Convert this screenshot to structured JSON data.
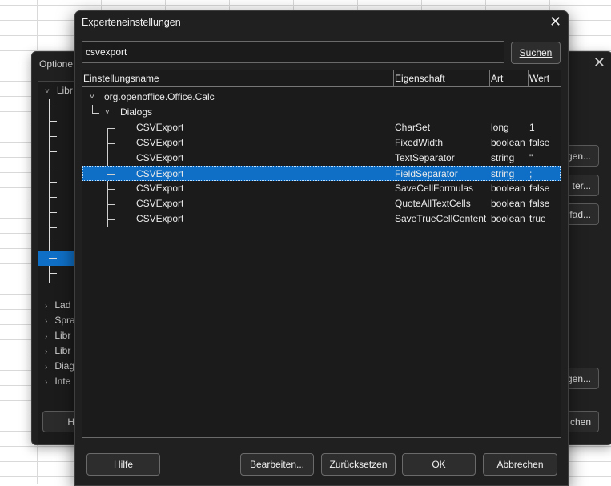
{
  "optionen": {
    "title": "Optione",
    "tree_items": [
      {
        "label": "Libr",
        "expanded": true
      },
      {
        "label": "Lad"
      },
      {
        "label": "Spra"
      },
      {
        "label": "Libr"
      },
      {
        "label": "Libr"
      },
      {
        "label": "Diag"
      },
      {
        "label": "Inte"
      }
    ],
    "right_buttons": [
      "gen...",
      "ter...",
      "fad...",
      "gen..."
    ],
    "bottom_left_button": "H",
    "bottom_right_button": "chen"
  },
  "expert": {
    "title": "Experteneinstellungen",
    "search_value": "csvexport",
    "search_button": "Suchen",
    "columns": [
      "Einstellungsname",
      "Eigenschaft",
      "Art",
      "Wert"
    ],
    "root": "org.openoffice.Office.Calc",
    "group": "Dialogs",
    "rows": [
      {
        "name": "CSVExport",
        "property": "CharSet",
        "type": "long",
        "value": "1"
      },
      {
        "name": "CSVExport",
        "property": "FixedWidth",
        "type": "boolean",
        "value": "false"
      },
      {
        "name": "CSVExport",
        "property": "TextSeparator",
        "type": "string",
        "value": "\""
      },
      {
        "name": "CSVExport",
        "property": "FieldSeparator",
        "type": "string",
        "value": ";"
      },
      {
        "name": "CSVExport",
        "property": "SaveCellFormulas",
        "type": "boolean",
        "value": "false"
      },
      {
        "name": "CSVExport",
        "property": "QuoteAllTextCells",
        "type": "boolean",
        "value": "false"
      },
      {
        "name": "CSVExport",
        "property": "SaveTrueCellContent",
        "type": "boolean",
        "value": "true"
      }
    ],
    "selected_row": 3,
    "buttons": {
      "help": "Hilfe",
      "edit": "Bearbeiten...",
      "reset": "Zurücksetzen",
      "ok": "OK",
      "cancel": "Abbrechen"
    }
  },
  "colors": {
    "selection": "#0f6fc6",
    "dialog_bg": "#202020"
  }
}
